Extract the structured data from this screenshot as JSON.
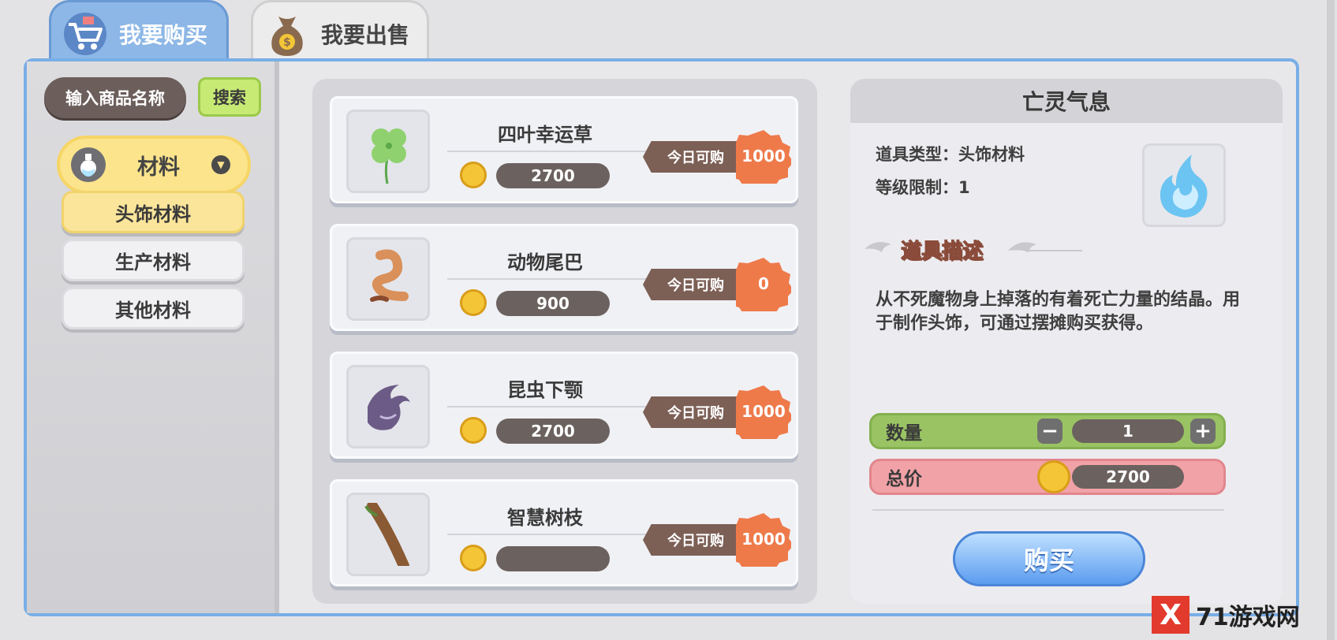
{
  "tabs": {
    "buy_label": "我要购买",
    "sell_label": "我要出售"
  },
  "search": {
    "placeholder": "输入商品名称",
    "button_label": "搜索"
  },
  "category": {
    "main_label": "材料",
    "sub_items": [
      "头饰材料",
      "生产材料",
      "其他材料"
    ],
    "active_index": 0
  },
  "items": [
    {
      "name": "四叶幸运草",
      "price": "2700",
      "today_label": "今日可购",
      "limit": "1000",
      "icon": "clover-icon"
    },
    {
      "name": "动物尾巴",
      "price": "900",
      "today_label": "今日可购",
      "limit": "0",
      "icon": "tail-icon"
    },
    {
      "name": "昆虫下颚",
      "price": "2700",
      "today_label": "今日可购",
      "limit": "1000",
      "icon": "mandible-icon"
    },
    {
      "name": "智慧树枝",
      "price": "",
      "today_label": "今日可购",
      "limit": "1000",
      "icon": "branch-icon"
    }
  ],
  "detail": {
    "title": "亡灵气息",
    "type_line": "道具类型：头饰材料",
    "level_line": "等级限制：1",
    "desc_title": "道具描述",
    "description": "从不死魔物身上掉落的有着死亡力量的结晶。用于制作头饰，可通过摆摊购买获得。",
    "qty_label": "数量",
    "qty_value": "1",
    "total_label": "总价",
    "total_value": "2700",
    "buy_label": "购买",
    "icon": "ghost-flame-icon"
  },
  "watermark": {
    "mark": "X",
    "text": "71游戏网"
  },
  "colors": {
    "tab_active": "#8cb7e6",
    "frame_border": "#79aee6",
    "limit_badge": "#ee7a4a",
    "qty_bar": "#9ac463",
    "total_bar": "#f1a2a7",
    "buy_button": "#5b9cef"
  }
}
